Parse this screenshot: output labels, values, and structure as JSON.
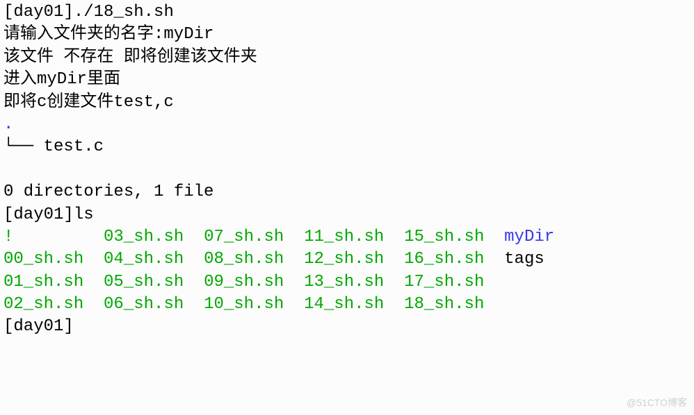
{
  "prompt1": "[day01]",
  "command1": "./18_sh.sh",
  "output": {
    "line1": "请输入文件夹的名字:myDir",
    "line2": "该文件 不存在 即将创建该文件夹",
    "line3": "进入myDir里面",
    "line4": "即将c创建文件test,c"
  },
  "tree": {
    "dot": ".",
    "file": "└── test.c",
    "summary": "0 directories, 1 file"
  },
  "prompt2": "[day01]",
  "command2": "ls",
  "ls": {
    "rows": [
      {
        "c1": "!       ",
        "c2": "03_sh.sh",
        "c3": "07_sh.sh",
        "c4": "11_sh.sh",
        "c5": "15_sh.sh",
        "c6": "myDir",
        "c6_type": "dir"
      },
      {
        "c1": "00_sh.sh",
        "c2": "04_sh.sh",
        "c3": "08_sh.sh",
        "c4": "12_sh.sh",
        "c5": "16_sh.sh",
        "c6": "tags",
        "c6_type": "file"
      },
      {
        "c1": "01_sh.sh",
        "c2": "05_sh.sh",
        "c3": "09_sh.sh",
        "c4": "13_sh.sh",
        "c5": "17_sh.sh",
        "c6": "",
        "c6_type": ""
      },
      {
        "c1": "02_sh.sh",
        "c2": "06_sh.sh",
        "c3": "10_sh.sh",
        "c4": "14_sh.sh",
        "c5": "18_sh.sh",
        "c6": "",
        "c6_type": ""
      }
    ]
  },
  "prompt3": "[day01]",
  "watermark": "@51CTO博客"
}
